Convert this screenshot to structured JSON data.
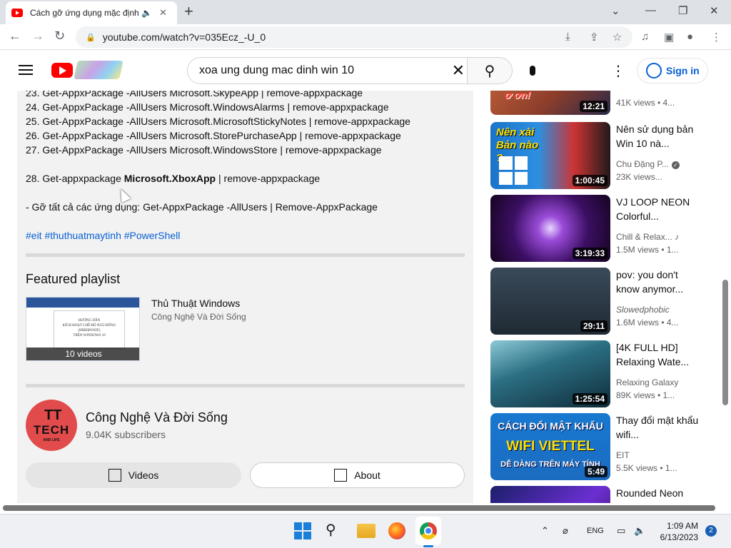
{
  "browser": {
    "tab_title": "Cách gỡ ứng dụng mặc định",
    "url": "youtube.com/watch?v=035Ecz_-U_0"
  },
  "header": {
    "search_query": "xoa ung dung mac dinh win 10",
    "signin_label": "Sign in"
  },
  "description": {
    "lines": [
      "23. Get-AppxPackage -AllUsers Microsoft.SkypeApp | remove-appxpackage",
      "24. Get-AppxPackage -AllUsers Microsoft.WindowsAlarms | remove-appxpackage",
      "25. Get-AppxPackage -AllUsers Microsoft.MicrosoftStickyNotes | remove-appxpackage",
      "26. Get-AppxPackage -AllUsers Microsoft.StorePurchaseApp | remove-appxpackage",
      "27. Get-AppxPackage -AllUsers Microsoft.WindowsStore | remove-appxpackage"
    ],
    "line28_prefix": "28. Get-appxpackage ",
    "line28_bold": "Microsoft.XboxApp",
    "line28_suffix": " | remove-appxpackage",
    "remove_all": "- Gỡ tất cả các ứng dụng: Get-AppxPackage -AllUsers | Remove-AppxPackage",
    "hashtags": "#eit #thuthuatmaytinh #PowerShell"
  },
  "featured": {
    "heading": "Featured playlist",
    "playlist_name": "Thủ Thuật Windows",
    "playlist_channel": "Công Nghệ Và Đời Sống",
    "video_count": "10 videos",
    "thumb_doc_lines": [
      "HƯỚNG DẪN",
      "KÍCH HOẠT CHẾ ĐỘ NGỦ ĐÔNG",
      "(HIBERNATE)",
      "TRÊN WINDOWS 10"
    ]
  },
  "channel": {
    "avatar_logo": "TT",
    "avatar_text": "TECH",
    "avatar_sub": "AND LIFE",
    "name": "Công Nghệ Và Đời Sống",
    "subscribers": "9.04K subscribers",
    "videos_button": "Videos",
    "about_button": "About"
  },
  "sidebar": {
    "videos": [
      {
        "title": "",
        "channel": "",
        "meta": "41K views • 4...",
        "duration": "12:21",
        "thumb_text": "ơ ơn!"
      },
      {
        "title": "Nên sử dụng bản Win 10 nà...",
        "channel": "Chu Đặng P...",
        "meta": "23K views...",
        "duration": "1:00:45",
        "thumb_text": "Nên xài Bản nào ?",
        "verified": "✓"
      },
      {
        "title": "VJ LOOP NEON Colorful...",
        "channel": "Chill & Relax...",
        "meta": "1.5M views • 1...",
        "duration": "3:19:33",
        "note": "♪"
      },
      {
        "title": "pov: you don't know anymor...",
        "channel": "Slowedphobic",
        "meta": "1.6M views • 4...",
        "duration": "29:11"
      },
      {
        "title": "[4K FULL HD] Relaxing Wate...",
        "channel": "Relaxing Galaxy",
        "meta": "89K views • 1...",
        "duration": "1:25:54"
      },
      {
        "title": "Thay đổi mật khẩu wifi...",
        "channel": "EIT",
        "meta": "5.5K views • 1...",
        "duration": "5:49",
        "thumb_text": "CÁCH ĐỔI MẬT KHẨU",
        "thumb_text2": "WIFI VIETTEL",
        "thumb_text3": "DỄ DÀNG TRÊN MÁY TÍNH"
      },
      {
        "title": "Rounded Neon",
        "channel": "",
        "meta": "",
        "duration": ""
      }
    ]
  },
  "taskbar": {
    "language": "ENG",
    "time": "1:09 AM",
    "date": "6/13/2023",
    "notifications": "2"
  },
  "colors": {
    "yt_red": "#ff0000",
    "link_blue": "#065fd4"
  }
}
